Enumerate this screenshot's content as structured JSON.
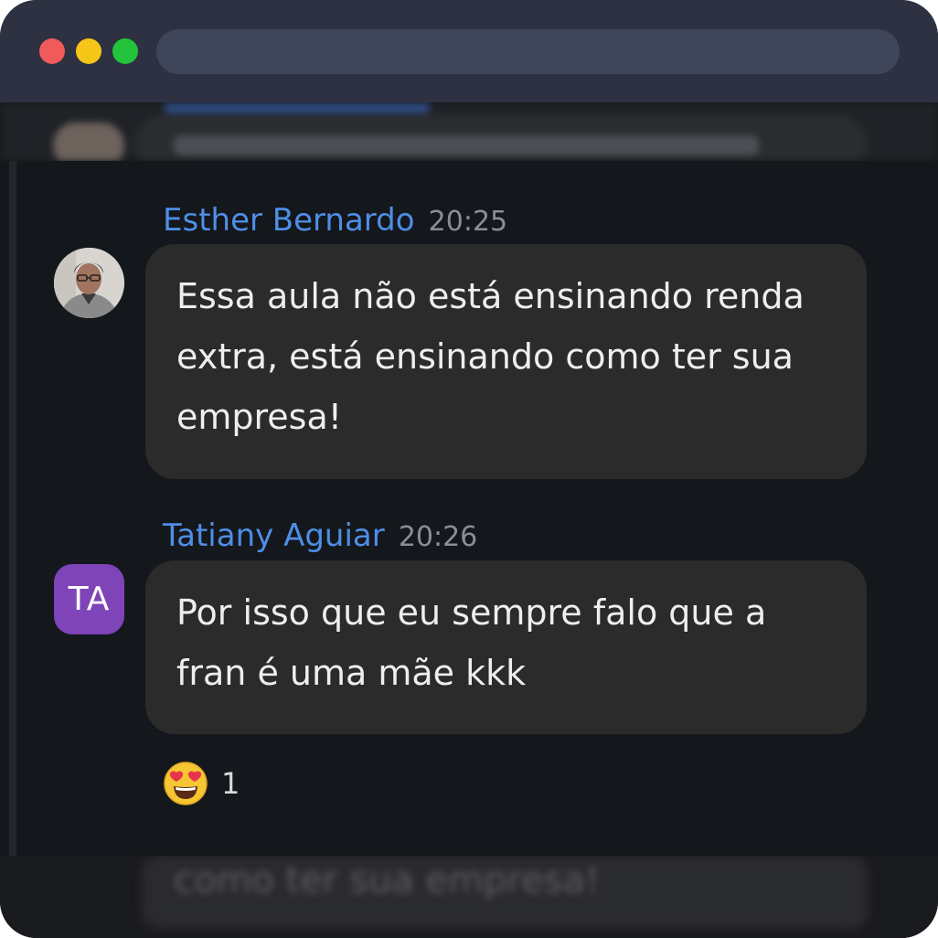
{
  "messages": [
    {
      "author": "Esther Bernardo",
      "time": "20:25",
      "text": "Essa aula não está ensinando renda extra, está ensinando como ter sua empresa!",
      "avatar": "photo"
    },
    {
      "author": "Tatiany Aguiar",
      "time": "20:26",
      "text": "Por isso que eu sempre falo que a fran é uma mãe kkk",
      "avatar_initials": "TA"
    }
  ],
  "reaction": {
    "emoji": "smiling-face-with-heart-eyes",
    "count": "1"
  },
  "blurred_preview": {
    "text": "como ter sua empresa!"
  },
  "colors": {
    "author": "#4e8ee6",
    "bubble": "#2b2b2c",
    "initials_avatar": "#7e44b8",
    "background": "#14171b",
    "titlebar": "#2d3142"
  }
}
